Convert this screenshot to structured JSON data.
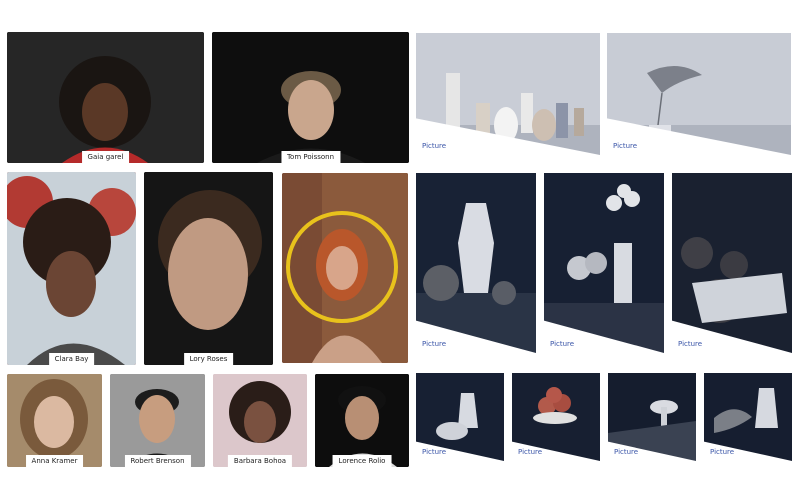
{
  "people": {
    "gaia": "Gaia garel",
    "tom": "Tom Poissonn",
    "clara": "Clara Bay",
    "lory": "Lory Roses",
    "anna": "Anna Kramer",
    "robert": "Robert Brenson",
    "barbara": "Barbara Bohoa",
    "lorence": "Lorence Rolio"
  },
  "picture_label": "Picture",
  "colors": {
    "accent_ring": "#e8c21c",
    "link_blue": "#3a55a8"
  }
}
